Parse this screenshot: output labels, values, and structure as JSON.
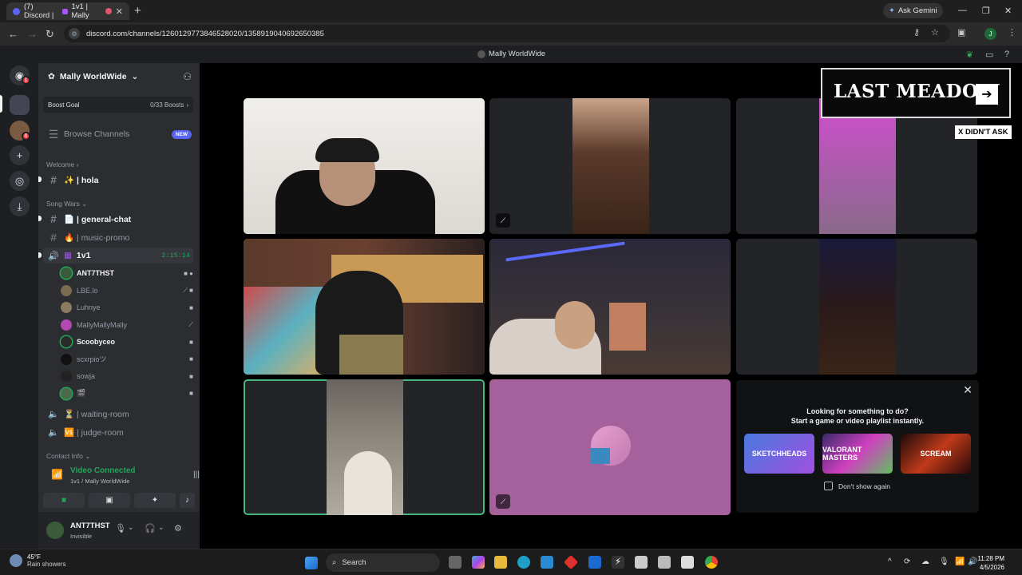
{
  "browser": {
    "tabs": [
      {
        "label": "(7) Discord | ",
        "color": "#5865f2",
        "has_close": true
      },
      {
        "label": "1v1 | Mally",
        "color": "#a855f7",
        "has_close": false
      }
    ],
    "new_tab": "+",
    "gemini": "Ask Gemini",
    "url": "discord.com/channels/1260129773846528020/1358919040692650385",
    "profile_letter": "J"
  },
  "app_title": "Mally WorldWide",
  "server": {
    "name": "Mally WorldWide",
    "boost_goal": "Boost Goal",
    "boost_count": "0/33 Boosts",
    "browse_channels": "Browse Channels",
    "new_badge": "NEW"
  },
  "rail_badges": [
    "1",
    "6"
  ],
  "categories": {
    "welcome": "Welcome",
    "song_wars": "Song Wars",
    "contact": "Contact Info"
  },
  "channels": [
    {
      "name": "✨ | hola",
      "unread": true
    },
    {
      "name": "📄 | general-chat",
      "unread": true
    },
    {
      "name": "🔥 | music-promo",
      "unread": false
    },
    {
      "name": "1v1",
      "timer": "2:15:14"
    },
    {
      "name": "⏳ | waiting-room"
    },
    {
      "name": "🆚 | judge-room"
    }
  ],
  "members": [
    {
      "name": "ANT7THST",
      "color": "#3a5a3a",
      "bright": true,
      "speaking": true,
      "icons": "■ ●"
    },
    {
      "name": "LBE.lo",
      "color": "#7a6a50",
      "bright": false,
      "speaking": false,
      "icons": "⟋ ■"
    },
    {
      "name": "Luhnye",
      "color": "#8a7a60",
      "bright": false,
      "speaking": false,
      "icons": "■"
    },
    {
      "name": "MallyMallyMally",
      "color": "#b04ab0",
      "bright": false,
      "speaking": false,
      "icons": "⟋"
    },
    {
      "name": "Scoobyceo",
      "color": "#2a2a2a",
      "bright": true,
      "speaking": true,
      "icons": "■"
    },
    {
      "name": "scxrpioツ",
      "color": "#111111",
      "bright": false,
      "speaking": false,
      "icons": "■"
    },
    {
      "name": "sowja",
      "color": "#222222",
      "bright": false,
      "speaking": false,
      "icons": "■"
    },
    {
      "name": "🎬",
      "color": "#4a6a4a",
      "bright": false,
      "speaking": true,
      "icons": "■"
    }
  ],
  "voice": {
    "status": "Video Connected",
    "location": "1v1 / Mally WorldWide"
  },
  "user": {
    "name": "ANT7THST",
    "status": "Invisible"
  },
  "overlay": {
    "title": "LAST MEADOW",
    "tag": "X DIDN'T ASK"
  },
  "activity": {
    "line1": "Looking for something to do?",
    "line2": "Start a game or video playlist instantly.",
    "games": [
      "SKETCHHEADS",
      "VALORANT MASTERS",
      "SCREAM"
    ],
    "dont_show": "Don't show again"
  },
  "taskbar": {
    "temp": "45°F",
    "weather": "Rain showers",
    "search": "Search",
    "time": "11:28 PM",
    "date": "4/5/2026"
  }
}
